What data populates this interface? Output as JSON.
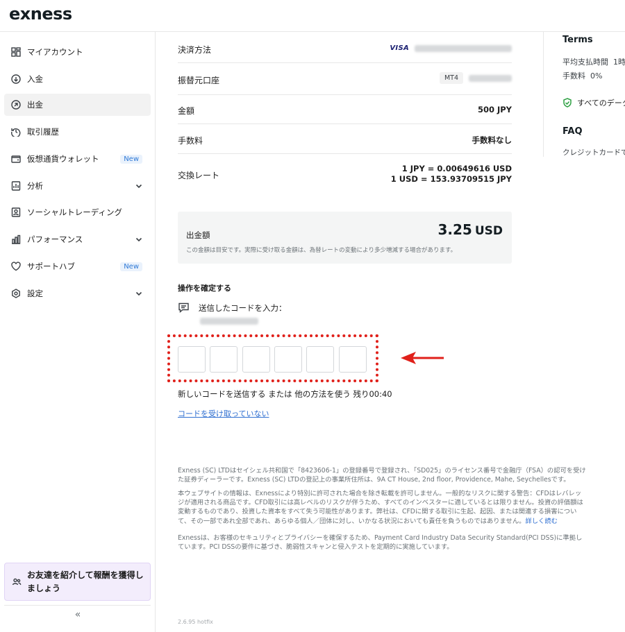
{
  "header": {
    "logo": "exness"
  },
  "sidebar": {
    "items": [
      {
        "label": "マイアカウント"
      },
      {
        "label": "入金"
      },
      {
        "label": "出金"
      },
      {
        "label": "取引履歴"
      },
      {
        "label": "仮想通貨ウォレット",
        "badge": "New"
      },
      {
        "label": "分析"
      },
      {
        "label": "ソーシャルトレーディング"
      },
      {
        "label": "パフォーマンス"
      },
      {
        "label": "サポートハブ",
        "badge": "New"
      },
      {
        "label": "設定"
      }
    ],
    "referral": "お友達を紹介して報酬を獲得しましょう",
    "collapse": "«"
  },
  "details": {
    "payment_method": {
      "label": "決済方法",
      "brand": "VISA"
    },
    "source_account": {
      "label": "振替元口座",
      "platform": "MT4"
    },
    "amount": {
      "label": "金額",
      "value": "500 JPY"
    },
    "fee": {
      "label": "手数料",
      "value": "手数料なし"
    },
    "rate": {
      "label": "交換レート",
      "line1": "1 JPY = 0.00649616 USD",
      "line2": "1 USD = 153.93709515 JPY"
    }
  },
  "summary": {
    "label": "出金額",
    "amount": "3.25",
    "currency": "USD",
    "note": "この金額は目安です。実際に受け取る金額は、為替レートの変動により多少増減する場合があります。"
  },
  "confirm": {
    "title": "操作を確定する",
    "sms_label": "送信したコードを入力：",
    "resend": "新しいコードを送信する または 他の方法を使う 残り",
    "timer": "00:40",
    "no_code_link": "コードを受け取っていない"
  },
  "legal": {
    "p1": "Exness (SC) LTDはセイシェル共和国で「8423606-1」の登録番号で登録され、「SD025」のライセンス番号で金融庁（FSA）の認可を受けた証券ディーラーです。Exness (SC) LTDの登記上の事業所住所は、9A CT House, 2nd floor, Providence, Mahe, Seychellesです。",
    "p2": "本ウェブサイトの情報は、Exnessにより特別に許可された場合を除き転載を許可しません。一般的なリスクに関する警告：CFDはレバレッジが適用される商品です。CFD取引には高レベルのリスクが伴うため、すべてのインベスターに適しているとは限りません。投資の評価額は変動するものであり、投資した資本をすべて失う可能性があります。弊社は、CFDに関する取引に生起、起因、または関連する損害について、その一部であれ全部であれ、あらゆる個人／団体に対し、いかなる状況においても責任を負うものではありません。",
    "p2_link": "詳しく読む",
    "p3": "Exnessは、お客様のセキュリティとプライバシーを確保するため、Payment Card Industry Data Security Standard(PCI DSS)に準拠しています。PCI DSSの要件に基づき、脆弱性スキャンと侵入テストを定期的に実施しています。"
  },
  "version": "2.6.95 hotfix",
  "right_panel": {
    "terms_title": "Terms",
    "time_label": "平均支払時間",
    "time_value": "1時",
    "fee_label": "手数料",
    "fee_value": "0%",
    "secure_text": "すべてのデータは",
    "faq_title": "FAQ",
    "faq_item": "クレジットカードで出金"
  },
  "colors": {
    "accent_link": "#2f6fd1",
    "annotation_red": "#e0201a",
    "badge_blue": "#2f79d6"
  }
}
